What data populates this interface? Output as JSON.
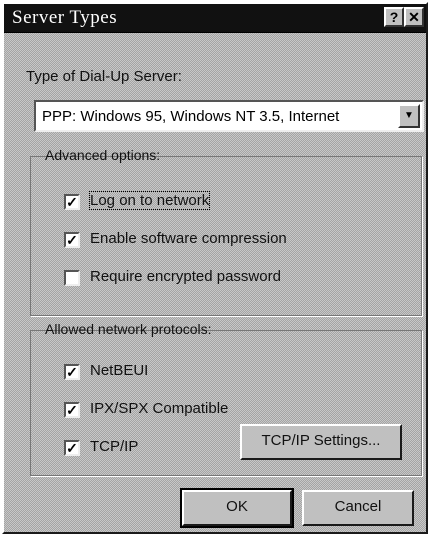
{
  "window": {
    "title": "Server Types"
  },
  "titlebar_buttons": [
    {
      "icon": "help-icon",
      "glyph": "?"
    },
    {
      "icon": "close-icon",
      "glyph": "✕"
    }
  ],
  "server": {
    "label": "Type of Dial-Up Server:",
    "selected": "PPP: Windows 95, Windows NT 3.5, Internet"
  },
  "advanced": {
    "legend": "Advanced options:",
    "options": [
      {
        "label": "Log on to network",
        "checked": true
      },
      {
        "label": "Enable software compression",
        "checked": true
      },
      {
        "label": "Require encrypted password",
        "checked": false
      }
    ]
  },
  "protocols": {
    "legend": "Allowed network protocols:",
    "items": [
      {
        "label": "NetBEUI",
        "checked": true
      },
      {
        "label": "IPX/SPX Compatible",
        "checked": true
      },
      {
        "label": "TCP/IP",
        "checked": true
      }
    ],
    "settings_button": "TCP/IP Settings..."
  },
  "buttons": {
    "ok": "OK",
    "cancel": "Cancel"
  }
}
